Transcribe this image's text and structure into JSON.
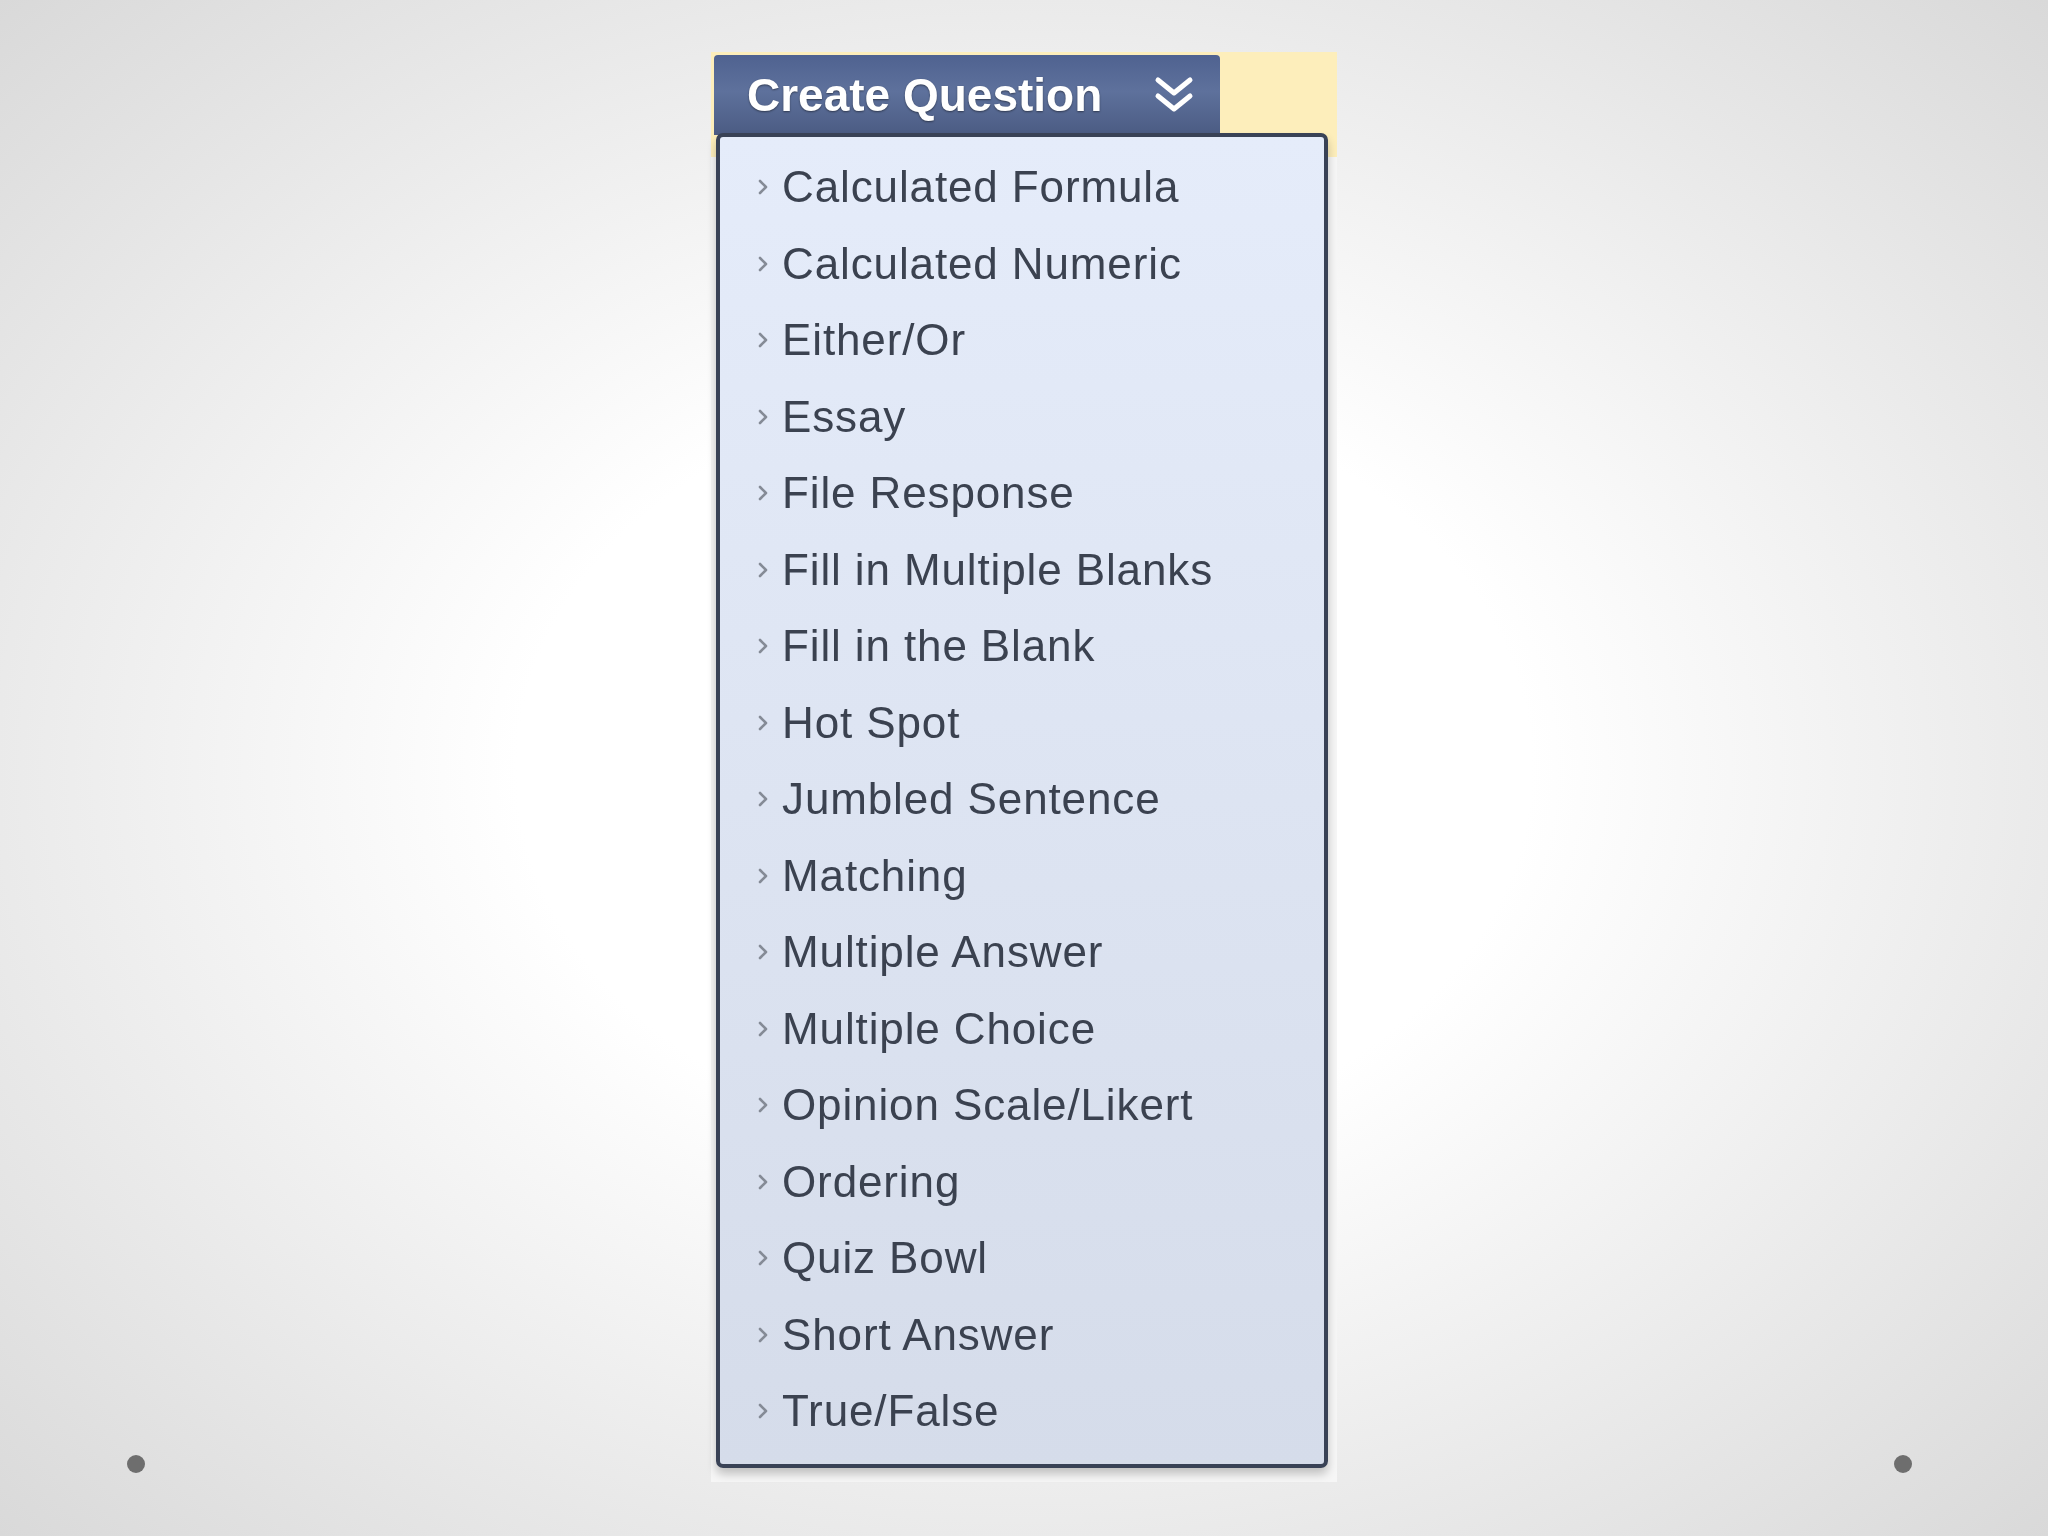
{
  "menu_button": {
    "label": "Create Question",
    "expanded": true
  },
  "menu_items": [
    {
      "label": "Calculated Formula"
    },
    {
      "label": "Calculated Numeric"
    },
    {
      "label": "Either/Or"
    },
    {
      "label": "Essay"
    },
    {
      "label": "File Response"
    },
    {
      "label": "Fill in Multiple Blanks"
    },
    {
      "label": "Fill in the Blank"
    },
    {
      "label": "Hot Spot"
    },
    {
      "label": "Jumbled Sentence"
    },
    {
      "label": "Matching"
    },
    {
      "label": "Multiple Answer"
    },
    {
      "label": "Multiple Choice"
    },
    {
      "label": "Opinion Scale/Likert"
    },
    {
      "label": "Ordering"
    },
    {
      "label": "Quiz Bowl"
    },
    {
      "label": "Short Answer"
    },
    {
      "label": "True/False"
    }
  ]
}
